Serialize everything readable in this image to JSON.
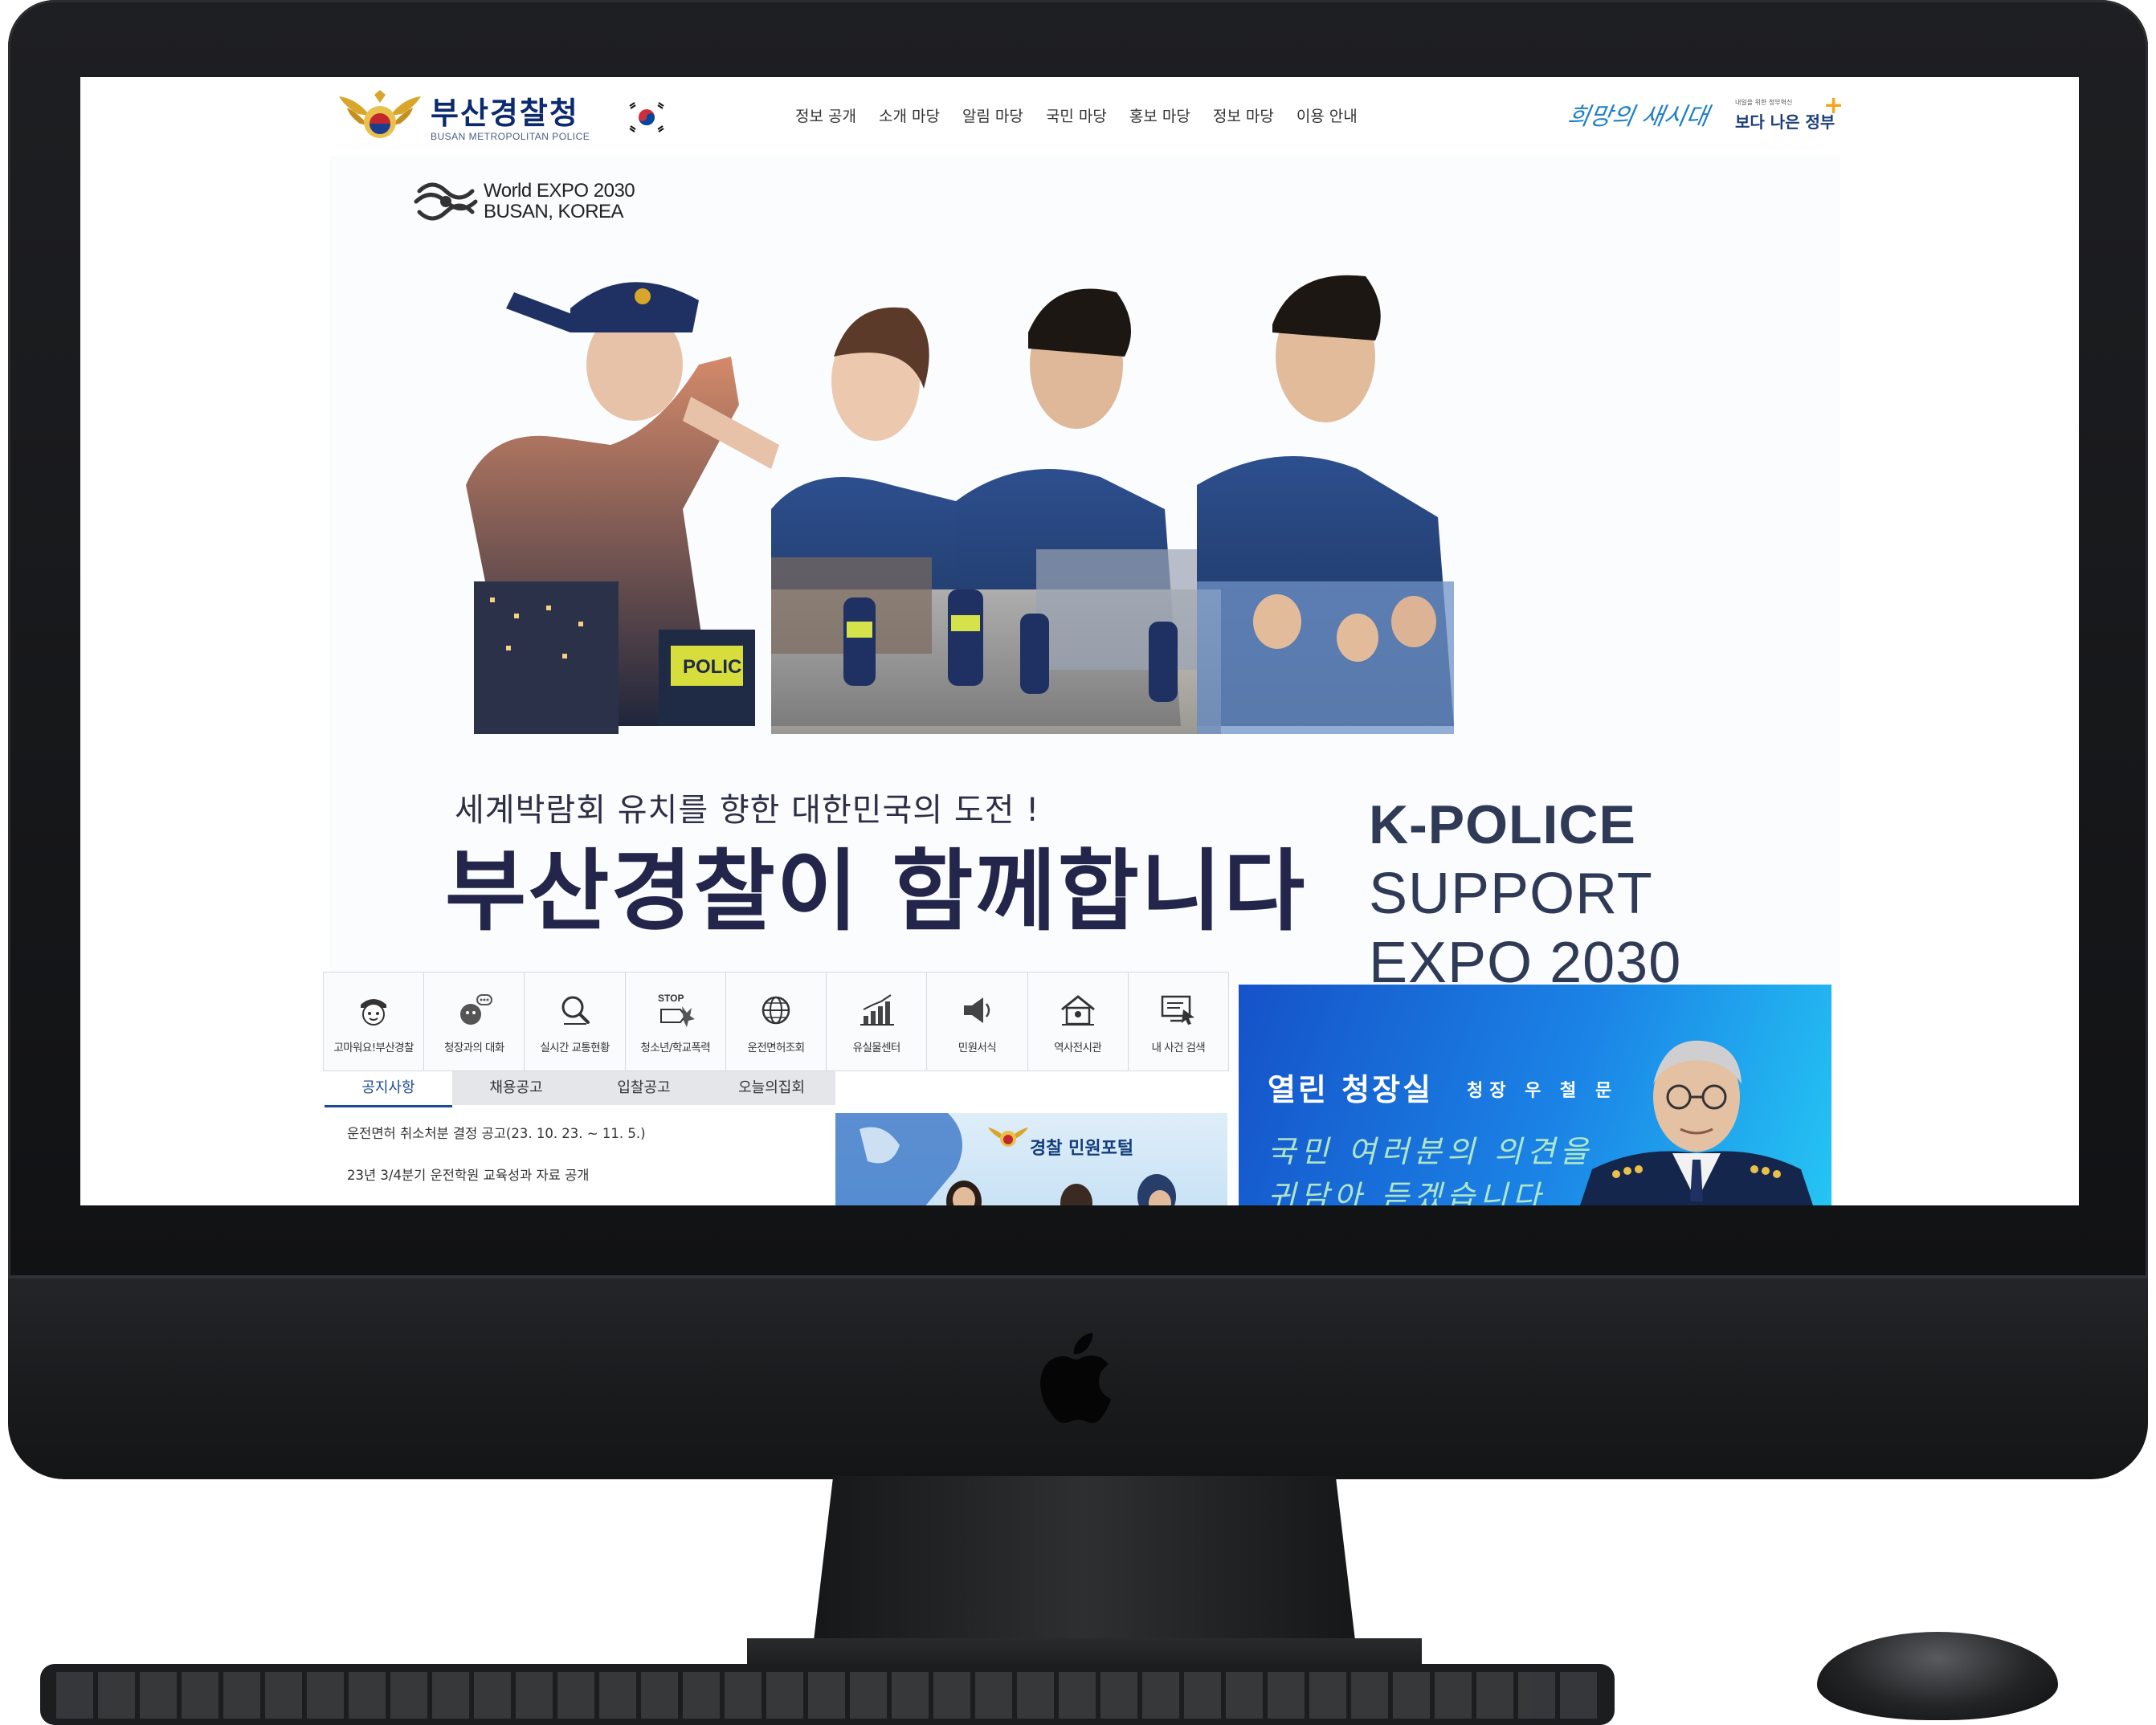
{
  "header": {
    "logo_kr": "부산경찰청",
    "logo_en": "BUSAN METROPOLITAN POLICE",
    "nav": [
      "정보 공개",
      "소개 마당",
      "알림 마당",
      "국민 마당",
      "홍보 마당",
      "정보 마당",
      "이용 안내"
    ],
    "slogan": "희망의 새시대",
    "gov_small": "내일을 위한 정부혁신",
    "gov_main": "보다 나은 정부"
  },
  "hero": {
    "expo_line1": "World EXPO 2030",
    "expo_line2": "BUSAN, KOREA",
    "subtitle": "세계박람회 유치를 향한 대한민국의 도전 !",
    "title": "부산경찰이 함께합니다",
    "kpolice_1": "K-POLICE",
    "kpolice_2": "SUPPORT",
    "kpolice_3": "EXPO 2030",
    "patch_text": "POLICE"
  },
  "quick_menu": [
    {
      "label": "고마워요!부산경찰",
      "icon": "police-mascot-icon"
    },
    {
      "label": "청장과의 대화",
      "icon": "chat-bubble-icon"
    },
    {
      "label": "실시간 교통현황",
      "icon": "magnifier-icon"
    },
    {
      "label": "청소년/학교폭력",
      "icon": "stop-sign-icon",
      "badge": "STOP"
    },
    {
      "label": "운전면허조회",
      "icon": "globe-icon"
    },
    {
      "label": "유실물센터",
      "icon": "chart-icon"
    },
    {
      "label": "민원서식",
      "icon": "megaphone-icon"
    },
    {
      "label": "역사전시관",
      "icon": "house-icon"
    },
    {
      "label": "내 사건 검색",
      "icon": "monitor-search-icon"
    }
  ],
  "notice": {
    "tabs": [
      "공지사항",
      "채용공고",
      "입찰공고",
      "오늘의집회"
    ],
    "active_tab": 0,
    "items": [
      "운전면허 취소처분 결정 공고(23. 10. 23. ~ 11. 5.)",
      "23년 3/4분기 운전학원 교육성과 자료 공개"
    ]
  },
  "portal": {
    "title": "경찰 민원포털"
  },
  "chief": {
    "title": "열린 청장실",
    "name": "청장 우 철 문",
    "message_1": "국민 여러분의 의견을",
    "message_2": "귀담아 듣겠습니다"
  },
  "colors": {
    "brand_navy": "#0b2a6f",
    "accent_blue": "#1c4b93",
    "banner_blue": "#1552c9",
    "banner_cyan": "#25c6f4",
    "slogan_blue": "#1e7fc6",
    "gov_plus_orange": "#f3a41a"
  }
}
